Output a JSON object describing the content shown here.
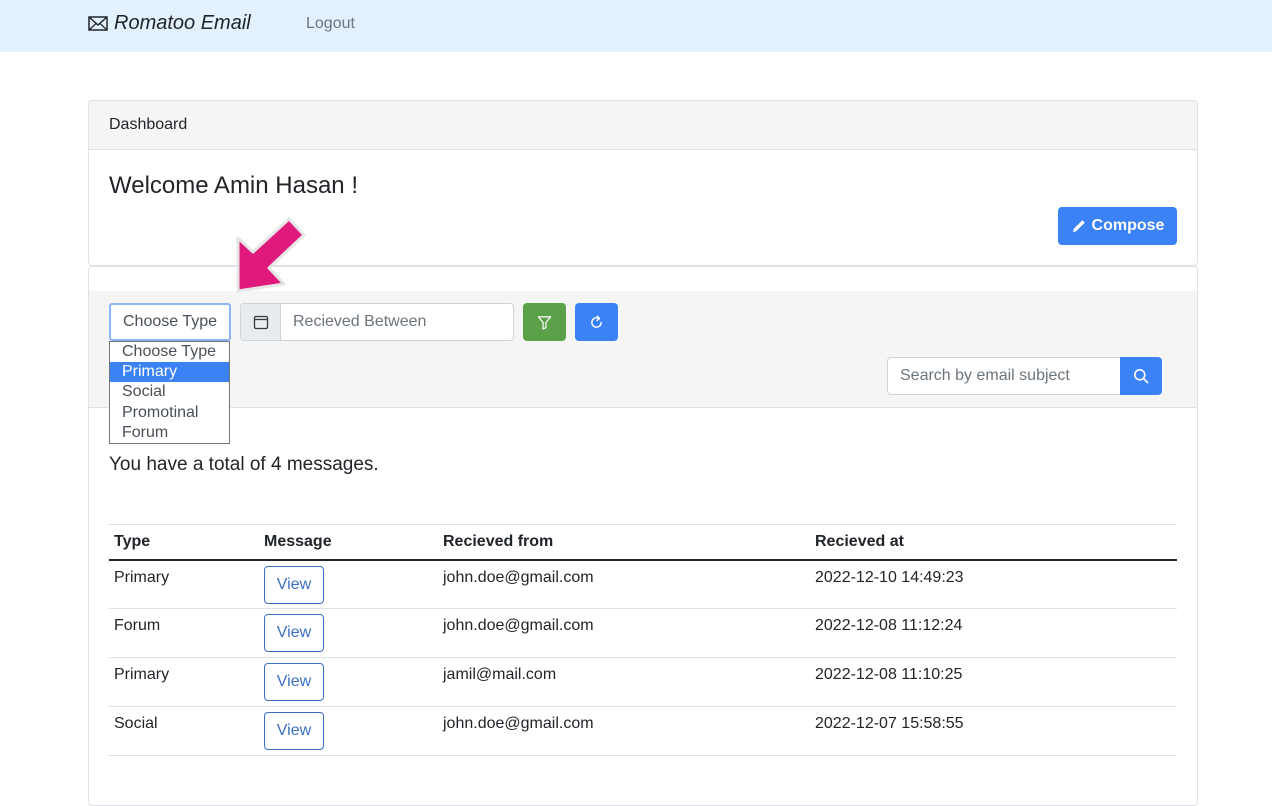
{
  "navbar": {
    "brand": "Romatoo Email",
    "logout": "Logout"
  },
  "dashboard": {
    "header": "Dashboard",
    "welcome": "Welcome Amin Hasan !",
    "compose": "Compose"
  },
  "filters": {
    "type_selected": "Choose Type",
    "type_options": [
      "Choose Type",
      "Primary",
      "Social",
      "Promotinal",
      "Forum"
    ],
    "highlighted_option": "Primary",
    "date_placeholder": "Recieved Between",
    "search_placeholder": "Search by email subject"
  },
  "summary": "You have a total of 4 messages.",
  "table": {
    "headers": [
      "Type",
      "Message",
      "Recieved from",
      "Recieved at"
    ],
    "rows": [
      {
        "type": "Primary",
        "action": "View",
        "from": "john.doe@gmail.com",
        "at": "2022-12-10 14:49:23"
      },
      {
        "type": "Forum",
        "action": "View",
        "from": "john.doe@gmail.com",
        "at": "2022-12-08 11:12:24"
      },
      {
        "type": "Primary",
        "action": "View",
        "from": "jamil@mail.com",
        "at": "2022-12-08 11:10:25"
      },
      {
        "type": "Social",
        "action": "View",
        "from": "john.doe@gmail.com",
        "at": "2022-12-07 15:58:55"
      }
    ]
  },
  "colors": {
    "navbar_bg": "#e3f0fd",
    "primary": "#3b82f6",
    "success": "#5aa14a",
    "annotation_arrow": "#e0197d"
  },
  "icons": [
    "envelope-icon",
    "pencil-icon",
    "calendar-icon",
    "funnel-icon",
    "refresh-icon",
    "search-icon",
    "annotation-arrow"
  ]
}
